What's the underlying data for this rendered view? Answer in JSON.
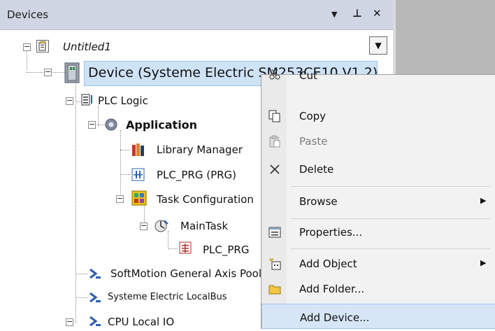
{
  "panel": {
    "title": "Devices",
    "pin_glyph": "⊥",
    "close_glyph": "✕",
    "dropdown_glyph": "▼"
  },
  "tree": {
    "root": "Untitled1",
    "device": "Device (Systeme Electric SM253CE10 V1.2)",
    "plc_logic": "PLC Logic",
    "application": "Application",
    "library_manager": "Library Manager",
    "plc_prg": "PLC_PRG (PRG)",
    "task_configuration": "Task Configuration",
    "main_task": "MainTask",
    "main_task_prg": "PLC_PRG",
    "softmotion": "SoftMotion General Axis Pool",
    "localbus": "Systeme Electric LocalBus",
    "cpu_local_io": "CPU Local IO"
  },
  "context_menu": {
    "items": [
      {
        "label": "Cut",
        "icon": "scissors-icon",
        "enabled": true,
        "submenu": false
      },
      {
        "label": "Copy",
        "icon": "copy-icon",
        "enabled": true,
        "submenu": false
      },
      {
        "label": "Paste",
        "icon": "paste-icon",
        "enabled": false,
        "submenu": false
      },
      {
        "label": "Delete",
        "icon": "delete-x-icon",
        "enabled": true,
        "submenu": false
      },
      {
        "label": "Browse",
        "icon": "",
        "enabled": true,
        "submenu": true
      },
      {
        "label": "Properties...",
        "icon": "properties-icon",
        "enabled": true,
        "submenu": false
      },
      {
        "label": "Add Object",
        "icon": "add-object-icon",
        "enabled": true,
        "submenu": true
      },
      {
        "label": "Add Folder...",
        "icon": "folder-icon",
        "enabled": true,
        "submenu": false
      },
      {
        "label": "Add Device...",
        "icon": "",
        "enabled": true,
        "submenu": false,
        "highlighted": true
      }
    ],
    "submenu_arrow": "▶"
  },
  "colors": {
    "titlebar": "#cfd5e3",
    "selection": "#cfe3f7",
    "menu_bg": "#f2f2f2"
  }
}
